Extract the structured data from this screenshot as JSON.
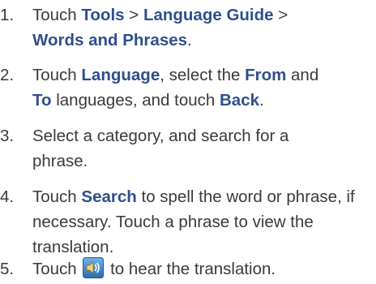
{
  "steps": [
    {
      "number": "1.",
      "parts": [
        "Touch ",
        "Tools",
        " > ",
        "Language Guide",
        " > ",
        "Words and Phrases",
        "."
      ]
    },
    {
      "number": "2.",
      "parts": [
        "Touch ",
        "Language",
        ", select the ",
        "From",
        " and ",
        "To",
        " languages, and touch ",
        "Back",
        "."
      ]
    },
    {
      "number": "3.",
      "parts": [
        "Select a category, and search for a phrase."
      ]
    },
    {
      "number": "4.",
      "parts": [
        "Touch ",
        "Search",
        " to spell the word or phrase, if necessary. Touch a phrase to view the translation."
      ]
    },
    {
      "number": "5.",
      "parts": [
        "Touch ",
        " to hear the translation."
      ],
      "icon": "speaker-icon"
    }
  ],
  "colors": {
    "text": "#3a3a3a",
    "emphasis": "#2e4f8d",
    "icon_bg": "#3a7fc1"
  }
}
